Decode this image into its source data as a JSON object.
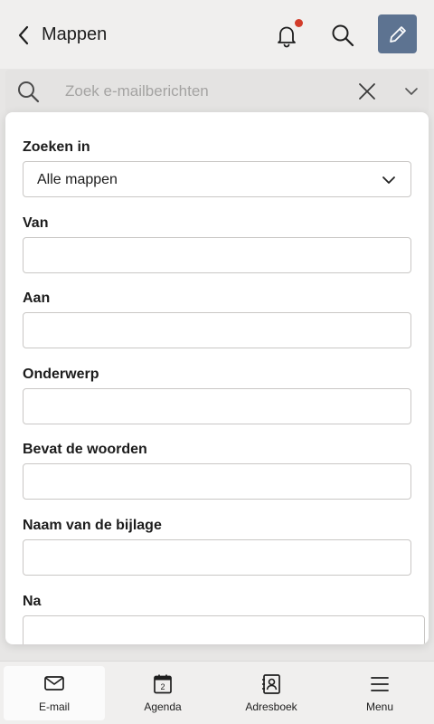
{
  "header": {
    "title": "Mappen",
    "back_icon": "chevron-left-icon",
    "bell_icon": "bell-icon",
    "search_icon": "search-icon",
    "compose_icon": "pencil-icon",
    "compose_color": "#5d7391",
    "notification_dot_color": "#d23c2a"
  },
  "search": {
    "placeholder": "Zoek e-mailberichten",
    "value": ""
  },
  "form": {
    "search_in_label": "Zoeken in",
    "search_in_value": "Alle mappen",
    "fields": [
      {
        "label": "Van",
        "value": ""
      },
      {
        "label": "Aan",
        "value": ""
      },
      {
        "label": "Onderwerp",
        "value": ""
      },
      {
        "label": "Bevat de woorden",
        "value": ""
      },
      {
        "label": "Naam van de bijlage",
        "value": ""
      },
      {
        "label": "Na",
        "value": ""
      }
    ]
  },
  "bottom_nav": {
    "items": [
      {
        "label": "E-mail",
        "icon": "envelope-icon",
        "active": true
      },
      {
        "label": "Agenda",
        "icon": "calendar-icon",
        "day": "2",
        "active": false
      },
      {
        "label": "Adresboek",
        "icon": "contacts-icon",
        "active": false
      },
      {
        "label": "Menu",
        "icon": "hamburger-icon",
        "active": false
      }
    ]
  }
}
